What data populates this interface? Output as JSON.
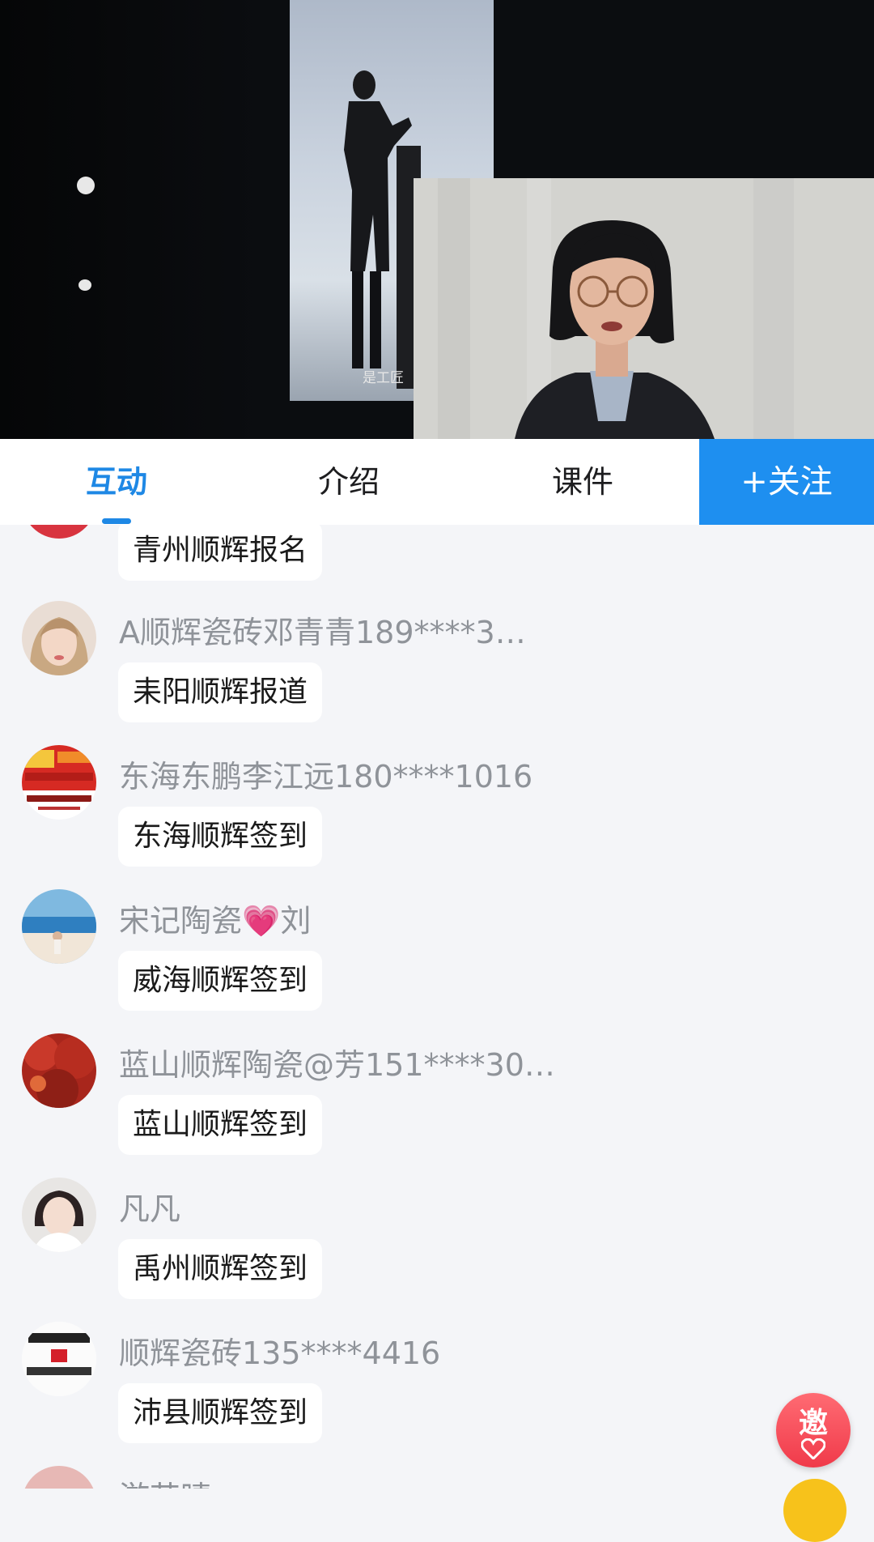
{
  "video": {
    "subtitle_fragment": "是工匠"
  },
  "tabs": [
    {
      "label": "互动",
      "active": true
    },
    {
      "label": "介绍",
      "active": false
    },
    {
      "label": "课件",
      "active": false
    }
  ],
  "follow_label": "+关注",
  "messages": [
    {
      "user": "",
      "text": "青州顺辉报名",
      "avatar": "red-avatar"
    },
    {
      "user": "A顺辉瓷砖邓青青189****3…",
      "text": "耒阳顺辉报道",
      "avatar": "woman-portrait-avatar"
    },
    {
      "user": "东海东鹏李江远180****1016",
      "text": "东海顺辉签到",
      "avatar": "store-banner-avatar"
    },
    {
      "user_prefix": "宋记陶瓷",
      "user_emoji": "💗",
      "user_suffix": "刘",
      "text": "威海顺辉签到",
      "avatar": "beach-avatar"
    },
    {
      "user": "蓝山顺辉陶瓷@芳151****30…",
      "text": "蓝山顺辉签到",
      "avatar": "red-foliage-avatar"
    },
    {
      "user": "凡凡",
      "text": "禹州顺辉签到",
      "avatar": "girl-selfie-avatar"
    },
    {
      "user": "顺辉瓷砖135****4416",
      "text": "沛县顺辉签到",
      "avatar": "brand-calligraphy-avatar"
    },
    {
      "user": "游艺晴",
      "text": "",
      "avatar": "pink-avatar"
    }
  ],
  "invite_label": "邀",
  "colors": {
    "accent": "#1e88e5",
    "follow_bg": "#1e8ff0",
    "chat_bg": "#f4f5f8",
    "username": "#8f9399",
    "invite": "#f03a4a"
  }
}
